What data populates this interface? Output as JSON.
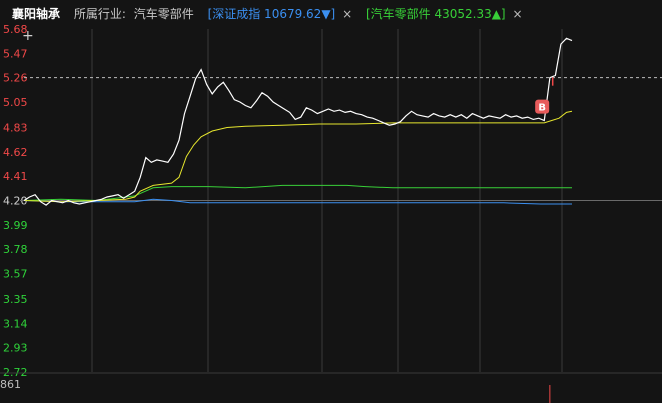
{
  "header": {
    "stock_name": "襄阳轴承",
    "industry_label": "所属行业:",
    "industry_value": "汽车零部件",
    "index1": "[深证成指 10679.62▼]",
    "index2": "[汽车零部件 43052.33▲]",
    "close_symbol": "×"
  },
  "colors": {
    "background": "#141414",
    "price_line": "#ffffff",
    "avg_line": "#e6e62e",
    "index1_line": "#3b8ff0",
    "index2_line": "#38d038",
    "up_color": "#f04848",
    "down_color": "#2fd33a",
    "grid": "#3a3a3a",
    "index1_text": "#3b8ff0",
    "index2_text": "#38d038"
  },
  "chart_data": {
    "type": "line",
    "y_ticks": [
      "5.68",
      "5.47",
      "5.26",
      "5.05",
      "4.83",
      "4.62",
      "4.41",
      "4.20",
      "3.99",
      "3.78",
      "3.57",
      "3.35",
      "3.14",
      "2.93",
      "2.72"
    ],
    "reference_price": 4.2,
    "ylim": [
      2.72,
      5.68
    ],
    "current_price_level": 5.26,
    "buy_marker_label": "B",
    "buy_marker_price": 5.01,
    "volume_top_label": "861",
    "x_total_minutes": 240,
    "series": [
      {
        "key": "price",
        "points": [
          [
            0,
            4.2
          ],
          [
            3,
            4.23
          ],
          [
            6,
            4.25
          ],
          [
            9,
            4.19
          ],
          [
            12,
            4.16
          ],
          [
            15,
            4.2
          ],
          [
            18,
            4.19
          ],
          [
            21,
            4.18
          ],
          [
            24,
            4.2
          ],
          [
            27,
            4.18
          ],
          [
            30,
            4.17
          ],
          [
            33,
            4.18
          ],
          [
            36,
            4.19
          ],
          [
            39,
            4.2
          ],
          [
            42,
            4.21
          ],
          [
            45,
            4.23
          ],
          [
            48,
            4.24
          ],
          [
            51,
            4.25
          ],
          [
            54,
            4.22
          ],
          [
            57,
            4.25
          ],
          [
            60,
            4.28
          ],
          [
            63,
            4.4
          ],
          [
            66,
            4.57
          ],
          [
            69,
            4.53
          ],
          [
            72,
            4.55
          ],
          [
            75,
            4.54
          ],
          [
            78,
            4.53
          ],
          [
            81,
            4.6
          ],
          [
            84,
            4.72
          ],
          [
            87,
            4.95
          ],
          [
            90,
            5.1
          ],
          [
            93,
            5.25
          ],
          [
            96,
            5.33
          ],
          [
            99,
            5.2
          ],
          [
            102,
            5.12
          ],
          [
            105,
            5.18
          ],
          [
            108,
            5.22
          ],
          [
            111,
            5.15
          ],
          [
            114,
            5.07
          ],
          [
            117,
            5.05
          ],
          [
            120,
            5.02
          ],
          [
            123,
            5.0
          ],
          [
            126,
            5.06
          ],
          [
            129,
            5.13
          ],
          [
            132,
            5.1
          ],
          [
            135,
            5.05
          ],
          [
            138,
            5.02
          ],
          [
            141,
            4.99
          ],
          [
            144,
            4.96
          ],
          [
            147,
            4.9
          ],
          [
            150,
            4.92
          ],
          [
            153,
            5.0
          ],
          [
            156,
            4.98
          ],
          [
            159,
            4.95
          ],
          [
            162,
            4.97
          ],
          [
            165,
            4.99
          ],
          [
            168,
            4.97
          ],
          [
            171,
            4.98
          ],
          [
            174,
            4.96
          ],
          [
            177,
            4.97
          ],
          [
            180,
            4.95
          ],
          [
            183,
            4.94
          ],
          [
            186,
            4.92
          ],
          [
            189,
            4.91
          ],
          [
            192,
            4.89
          ],
          [
            195,
            4.87
          ],
          [
            198,
            4.85
          ],
          [
            201,
            4.86
          ],
          [
            204,
            4.88
          ],
          [
            207,
            4.93
          ],
          [
            210,
            4.97
          ],
          [
            213,
            4.94
          ],
          [
            216,
            4.93
          ],
          [
            219,
            4.92
          ],
          [
            222,
            4.95
          ],
          [
            225,
            4.93
          ],
          [
            228,
            4.92
          ],
          [
            231,
            4.94
          ],
          [
            234,
            4.92
          ],
          [
            237,
            4.94
          ],
          [
            240,
            4.91
          ],
          [
            243,
            4.95
          ],
          [
            246,
            4.93
          ],
          [
            249,
            4.91
          ],
          [
            252,
            4.93
          ],
          [
            255,
            4.92
          ],
          [
            258,
            4.91
          ],
          [
            261,
            4.94
          ],
          [
            264,
            4.92
          ],
          [
            267,
            4.93
          ],
          [
            270,
            4.91
          ],
          [
            273,
            4.92
          ],
          [
            276,
            4.9
          ],
          [
            279,
            4.91
          ],
          [
            282,
            4.89
          ],
          [
            285,
            5.26
          ],
          [
            288,
            5.28
          ],
          [
            291,
            5.55
          ],
          [
            294,
            5.6
          ],
          [
            297,
            5.58
          ]
        ]
      },
      {
        "key": "avg",
        "points": [
          [
            0,
            4.2
          ],
          [
            20,
            4.19
          ],
          [
            40,
            4.2
          ],
          [
            55,
            4.21
          ],
          [
            60,
            4.23
          ],
          [
            63,
            4.28
          ],
          [
            70,
            4.33
          ],
          [
            80,
            4.35
          ],
          [
            84,
            4.4
          ],
          [
            88,
            4.58
          ],
          [
            92,
            4.68
          ],
          [
            96,
            4.75
          ],
          [
            102,
            4.8
          ],
          [
            110,
            4.83
          ],
          [
            120,
            4.84
          ],
          [
            140,
            4.85
          ],
          [
            160,
            4.86
          ],
          [
            180,
            4.86
          ],
          [
            200,
            4.87
          ],
          [
            220,
            4.87
          ],
          [
            240,
            4.87
          ],
          [
            260,
            4.87
          ],
          [
            282,
            4.87
          ],
          [
            286,
            4.89
          ],
          [
            290,
            4.91
          ],
          [
            294,
            4.96
          ],
          [
            297,
            4.97
          ]
        ]
      },
      {
        "key": "index2",
        "points": [
          [
            0,
            4.2
          ],
          [
            20,
            4.21
          ],
          [
            40,
            4.2
          ],
          [
            60,
            4.24
          ],
          [
            70,
            4.31
          ],
          [
            80,
            4.32
          ],
          [
            100,
            4.32
          ],
          [
            120,
            4.31
          ],
          [
            140,
            4.33
          ],
          [
            160,
            4.33
          ],
          [
            175,
            4.33
          ],
          [
            185,
            4.32
          ],
          [
            200,
            4.31
          ],
          [
            220,
            4.31
          ],
          [
            240,
            4.31
          ],
          [
            260,
            4.31
          ],
          [
            280,
            4.31
          ],
          [
            297,
            4.31
          ]
        ]
      },
      {
        "key": "index1",
        "points": [
          [
            0,
            4.2
          ],
          [
            20,
            4.19
          ],
          [
            40,
            4.19
          ],
          [
            60,
            4.19
          ],
          [
            70,
            4.21
          ],
          [
            80,
            4.2
          ],
          [
            90,
            4.18
          ],
          [
            100,
            4.18
          ],
          [
            120,
            4.18
          ],
          [
            140,
            4.18
          ],
          [
            160,
            4.18
          ],
          [
            180,
            4.18
          ],
          [
            200,
            4.18
          ],
          [
            220,
            4.18
          ],
          [
            240,
            4.18
          ],
          [
            260,
            4.18
          ],
          [
            280,
            4.17
          ],
          [
            297,
            4.17
          ]
        ]
      }
    ],
    "volume_bar_minute": 285
  }
}
